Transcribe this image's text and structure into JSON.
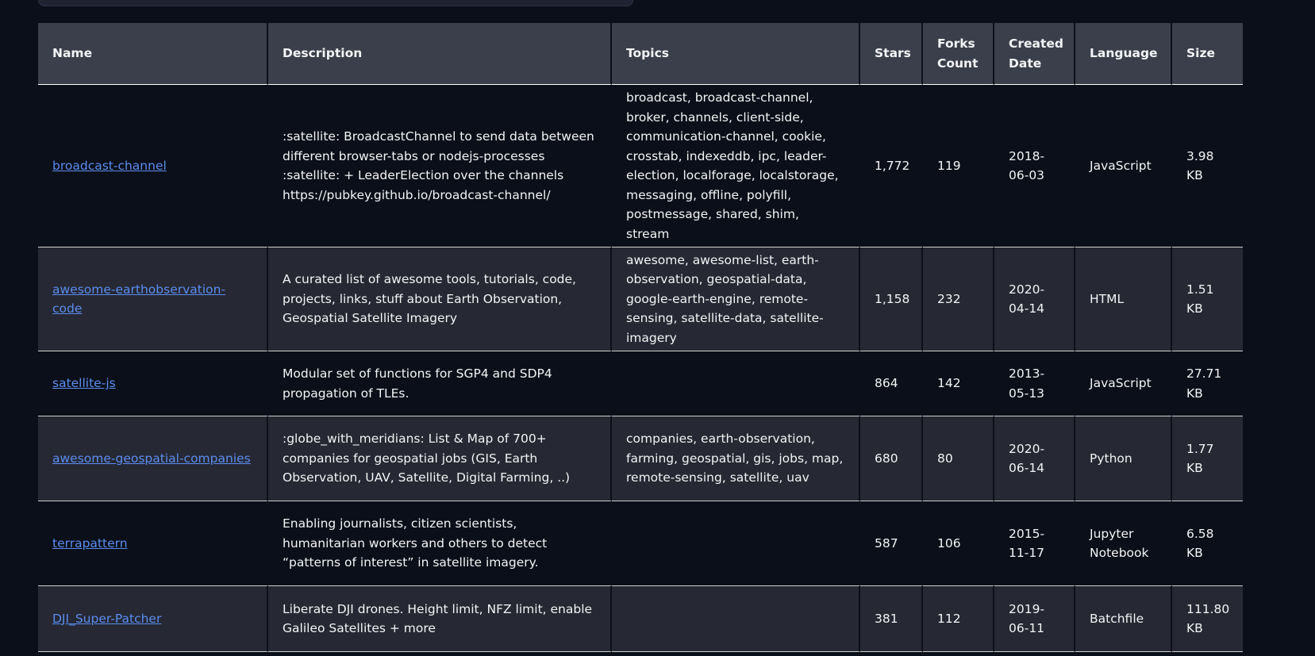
{
  "table": {
    "headers": {
      "name": "Name",
      "description": "Description",
      "topics": "Topics",
      "stars": "Stars",
      "forks": "Forks Count",
      "created": "Created Date",
      "language": "Language",
      "size": "Size"
    },
    "rows": [
      {
        "name": "broadcast-channel",
        "description": ":satellite: BroadcastChannel to send data between different browser-tabs or nodejs-processes :satellite: + LeaderElection over the channels https://pubkey.github.io/broadcast-channel/",
        "topics": "broadcast, broadcast-channel, broker, channels, client-side, communication-channel, cookie, crosstab, indexeddb, ipc, leader-election, localforage, localstorage, messaging, offline, polyfill, postmessage, shared, shim, stream",
        "stars": "1,772",
        "forks": "119",
        "created": "2018-06-03",
        "language": "JavaScript",
        "size": "3.98 KB"
      },
      {
        "name": "awesome-earthobservation-code",
        "description": "A curated list of awesome tools, tutorials, code, projects, links, stuff about Earth Observation, Geospatial Satellite Imagery",
        "topics": "awesome, awesome-list, earth-observation, geospatial-data, google-earth-engine, remote-sensing, satellite-data, satellite-imagery",
        "stars": "1,158",
        "forks": "232",
        "created": "2020-04-14",
        "language": "HTML",
        "size": "1.51 KB"
      },
      {
        "name": "satellite-js",
        "description": "Modular set of functions for SGP4 and SDP4 propagation of TLEs.",
        "topics": "",
        "stars": "864",
        "forks": "142",
        "created": "2013-05-13",
        "language": "JavaScript",
        "size": "27.71 KB"
      },
      {
        "name": "awesome-geospatial-companies",
        "description": ":globe_with_meridians: List & Map of 700+ companies for geospatial jobs (GIS, Earth Observation, UAV, Satellite, Digital Farming, ..)",
        "topics": "companies, earth-observation, farming, geospatial, gis, jobs, map, remote-sensing, satellite, uav",
        "stars": "680",
        "forks": "80",
        "created": "2020-06-14",
        "language": "Python",
        "size": "1.77 KB"
      },
      {
        "name": "terrapattern",
        "description": "Enabling journalists, citizen scientists, humanitarian workers and others to detect “patterns of interest” in satellite imagery.",
        "topics": "",
        "stars": "587",
        "forks": "106",
        "created": "2015-11-17",
        "language": "Jupyter Notebook",
        "size": "6.58 KB"
      },
      {
        "name": "DJI_Super-Patcher",
        "description": "Liberate DJI drones. Height limit, NFZ limit, enable Galileo Satellites + more",
        "topics": "",
        "stars": "381",
        "forks": "112",
        "created": "2019-06-11",
        "language": "Batchfile",
        "size": "111.80 KB"
      }
    ]
  }
}
